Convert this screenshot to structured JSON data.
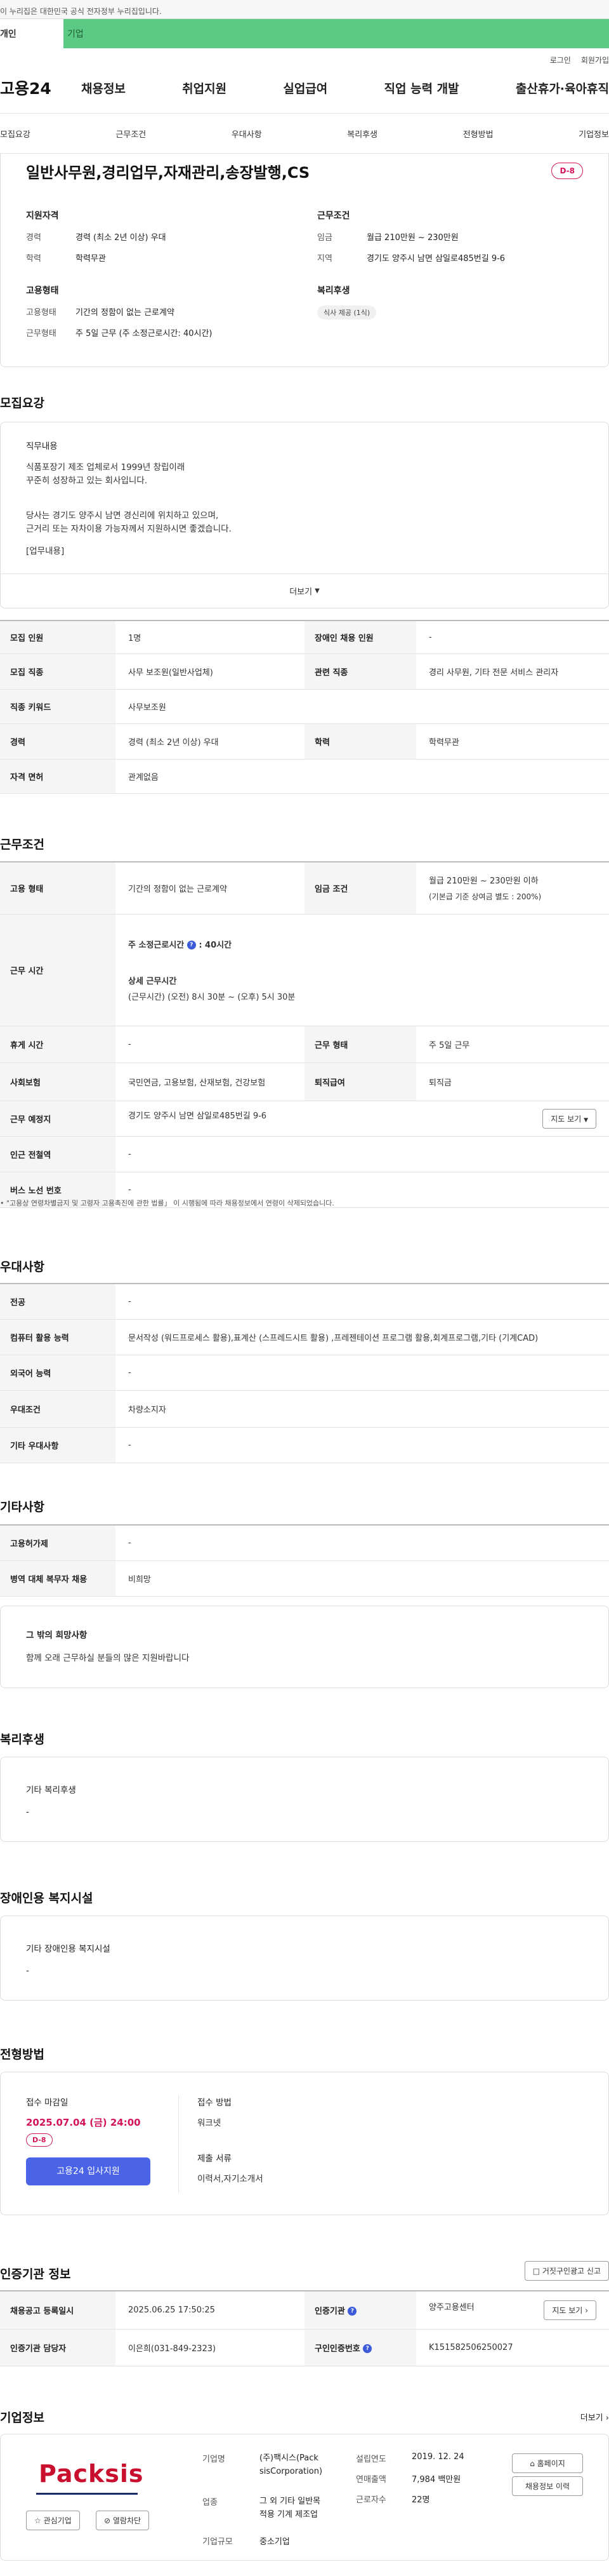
{
  "gov_notice": "이 누리집은 대한민국 공식 전자정부 누리집입니다.",
  "gov_tabs": [
    "개인",
    "기업"
  ],
  "util": {
    "login": "로그인",
    "signup": "회원가입"
  },
  "logo": "고용24",
  "gnb": [
    "채용정보",
    "취업지원",
    "실업급여",
    "직업 능력 개발",
    "출산휴가·육아휴직"
  ],
  "subnav": [
    "모집요강",
    "근무조건",
    "우대사항",
    "복리후생",
    "전형방법",
    "기업정보"
  ],
  "summary": {
    "title": "일반사무원,경리업무,자재관리,송장발행,CS",
    "dday": "D-8",
    "qual_title": "지원자격",
    "career_k": "경력",
    "career_v": "경력 (최소 2년 이상) 우대",
    "edu_k": "학력",
    "edu_v": "학력무관",
    "cond_title": "근무조건",
    "wage_k": "임금",
    "wage_v": "월급 210만원 ~ 230만원",
    "region_k": "지역",
    "region_v": "경기도 양주시 남면 삼일로485번길 9-6",
    "emp_title": "고용형태",
    "emptype_k": "고용형태",
    "emptype_v": "기간의 정함이 없는 근로계약",
    "worktype_k": "근무형태",
    "worktype_v": "주 5일 근무 (주 소정근로시간: 40시간)",
    "welfare_title": "복리후생",
    "welfare_chip": "식사 제공 (1식)"
  },
  "recruit": {
    "title": "모집요강",
    "job_label": "직무내용",
    "p1a": "식품포장기 제조 업체로서 1999년 창립이래",
    "p1b": "꾸준히 성장하고 있는 회사입니다.",
    "p2a": "당사는 경기도 양주시 남면 경신리에 위치하고 있으며,",
    "p2b": "근거리 또는 자차이용 가능자께서 지원하시면 좋겠습니다.",
    "p3": "[업무내용]",
    "more": "더보기",
    "rows": [
      {
        "k1": "모집 인원",
        "v1": "1명",
        "k2": "장애인 채용 인원",
        "v2": "-"
      },
      {
        "k1": "모집 직종",
        "v1": "사무 보조원(일반사업체)",
        "k2": "관련 직종",
        "v2": "경리 사무원, 기타 전문 서비스 관리자"
      },
      {
        "k1": "직종 키워드",
        "v1": "사무보조원"
      },
      {
        "k1": "경력",
        "v1": "경력 (최소 2년 이상) 우대",
        "k2": "학력",
        "v2": "학력무관"
      },
      {
        "k1": "자격 면허",
        "v1": "관계없음"
      }
    ]
  },
  "work": {
    "title": "근무조건",
    "emp_k": "고용 형태",
    "emp_v": "기간의 정함이 없는 근로계약",
    "wage_k": "임금 조건",
    "wage_v1": "월급 210만원 ~ 230만원 이하",
    "wage_v2": "(기본급 기준 상여금 별도 : 200%)",
    "hours_k": "근무 시간",
    "hours_week": "주 소정근로시간",
    "hours_week_v": ": 40시간",
    "hours_detail_t": "상세 근무시간",
    "hours_detail_v": "(근무시간) (오전) 8시 30분 ~ (오후) 5시 30분",
    "rest_k": "휴게 시간",
    "rest_v": "-",
    "form_k": "근무 형태",
    "form_v": "주 5일 근무",
    "ins_k": "사회보험",
    "ins_v": "국민연금, 고용보험, 산재보험, 건강보험",
    "ret_k": "퇴직급여",
    "ret_v": "퇴직금",
    "place_k": "근무 예정지",
    "place_v": "경기도 양주시 남면 삼일로485번길 9-6",
    "map_btn": "지도 보기",
    "subway_k": "인근 전철역",
    "subway_v": "-",
    "bus_k": "버스 노선 번호",
    "bus_v": "-",
    "note": "\"고용상 연령차별금지 및 고령자 고용촉진에 관한 법률」 이 시행됨에 따라 채용정보에서 연령이 삭제되었습니다."
  },
  "pref": {
    "title": "우대사항",
    "rows": [
      {
        "k": "전공",
        "v": "-"
      },
      {
        "k": "컴퓨터 활용 능력",
        "v": "문서작성 (워드프로세스 활용),표계산 (스프레드시트 활용) ,프레젠테이션 프로그램 활용,회계프로그램,기타 (기계CAD)"
      },
      {
        "k": "외국어 능력",
        "v": "-"
      },
      {
        "k": "우대조건",
        "v": "차량소지자"
      },
      {
        "k": "기타 우대사항",
        "v": "-"
      }
    ]
  },
  "etc": {
    "title": "기타사항",
    "rows": [
      {
        "k": "고용허가제",
        "v": "-"
      },
      {
        "k": "병역 대체 복무자 채용",
        "v": "비희망"
      }
    ],
    "wish_title": "그 밖의 희망사항",
    "wish_text": "함께 오래 근무하실 분들의 많은 지원바랍니다"
  },
  "welfare": {
    "title": "복리후생",
    "label": "기타 복리후생",
    "value": "-"
  },
  "disabled": {
    "title": "장애인용 복지시설",
    "label": "기타 장애인용 복지시설",
    "value": "-"
  },
  "select": {
    "title": "전형방법",
    "deadline_label": "접수 마감일",
    "deadline": "2025.07.04 (금) 24:00",
    "dday": "D-8",
    "apply": "고용24 입사지원",
    "method_label": "접수 방법",
    "method": "워크넷",
    "docs_label": "제출 서류",
    "docs": "이력서,자기소개서"
  },
  "cert": {
    "title": "인증기관 정보",
    "report_btn": "거짓구인광고 신고",
    "reg_k": "채용공고 등록일시",
    "reg_v": "2025.06.25 17:50:25",
    "org_k": "인증기관",
    "org_v": "양주고용센터",
    "map_btn": "지도 보기",
    "mgr_k": "인증기관 담당자",
    "mgr_v": "이은희(031-849-2323)",
    "no_k": "구인인증번호",
    "no_v": "K151582506250027"
  },
  "company": {
    "title": "기업정보",
    "more": "더보기",
    "logo_text": "Packsis",
    "interest_btn": "관심기업",
    "block_btn": "열람차단",
    "name_k": "기업명",
    "name_v1": "(주)팩시스(Pack",
    "name_v2": "sisCorporation)",
    "ind_k": "업종",
    "ind_v1": "그 외 기타 일반목",
    "ind_v2": "적용 기계 제조업",
    "size_k": "기업규모",
    "size_v": "중소기업",
    "est_k": "설립연도",
    "est_v": "2019. 12. 24",
    "sales_k": "연매출액",
    "sales_v": "7,984 백만원",
    "staff_k": "근로자수",
    "staff_v": "22명",
    "home_btn": "홈페이지",
    "jobs_btn": "채용정보 이력",
    "colors": {
      "brand_red": "#c8102e",
      "brand_navy": "#1b2a6b"
    }
  },
  "colors": {
    "green": "#5cc985",
    "dday": "#d4145a",
    "apply": "#4a63e7"
  }
}
